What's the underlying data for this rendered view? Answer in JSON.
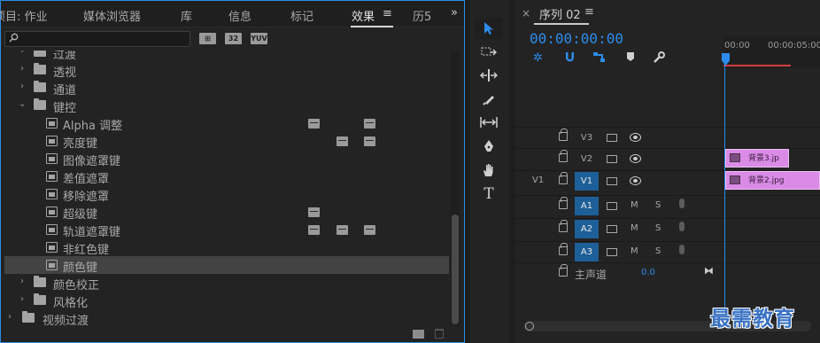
{
  "effects_panel": {
    "tabs": [
      {
        "label": "项目: 作业",
        "active": false
      },
      {
        "label": "媒体浏览器",
        "active": false
      },
      {
        "label": "库",
        "active": false
      },
      {
        "label": "信息",
        "active": false
      },
      {
        "label": "标记",
        "active": false
      },
      {
        "label": "效果",
        "active": true
      },
      {
        "label": "历5",
        "active": false
      }
    ],
    "menu_icon": "hamburger-icon",
    "overflow_icon": "double-chevron-right-icon",
    "search": {
      "value": "",
      "placeholder": ""
    },
    "accel_badges": [
      "accelerated-effects-icon",
      "32-bit-color-icon",
      "yuv-effects-icon"
    ],
    "tree": [
      {
        "label": "过渡",
        "type": "folder",
        "expanded": false,
        "level": 1
      },
      {
        "label": "透视",
        "type": "folder",
        "expanded": false,
        "level": 1
      },
      {
        "label": "通道",
        "type": "folder",
        "expanded": false,
        "level": 1
      },
      {
        "label": "键控",
        "type": "folder",
        "expanded": true,
        "level": 1
      },
      {
        "label": "Alpha 调整",
        "type": "effect",
        "level": 2,
        "badges": [
          "accel",
          "yuv"
        ]
      },
      {
        "label": "亮度键",
        "type": "effect",
        "level": 2,
        "badges": [
          "32",
          "yuv"
        ]
      },
      {
        "label": "图像遮罩键",
        "type": "effect",
        "level": 2,
        "badges": []
      },
      {
        "label": "差值遮罩",
        "type": "effect",
        "level": 2,
        "badges": []
      },
      {
        "label": "移除遮罩",
        "type": "effect",
        "level": 2,
        "badges": []
      },
      {
        "label": "超级键",
        "type": "effect",
        "level": 2,
        "badges": [
          "accel"
        ]
      },
      {
        "label": "轨道遮罩键",
        "type": "effect",
        "level": 2,
        "badges": [
          "accel",
          "32",
          "yuv"
        ]
      },
      {
        "label": "非红色键",
        "type": "effect",
        "level": 2,
        "badges": []
      },
      {
        "label": "颜色键",
        "type": "effect",
        "level": 2,
        "badges": [],
        "selected": true
      },
      {
        "label": "颜色校正",
        "type": "folder",
        "expanded": false,
        "level": 1
      },
      {
        "label": "风格化",
        "type": "folder",
        "expanded": false,
        "level": 1
      },
      {
        "label": "视频过渡",
        "type": "folder",
        "expanded": false,
        "level": 0
      }
    ],
    "bottom_icons": [
      "new-custom-bin-icon",
      "delete-icon"
    ]
  },
  "tools": [
    "selection-tool-icon",
    "track-select-icon",
    "ripple-edit-icon",
    "razor-icon",
    "slip-icon",
    "pen-icon",
    "hand-icon",
    "type-tool-icon"
  ],
  "timeline": {
    "close_label": "×",
    "sequence_title": "序列 02",
    "menu_label": "≡",
    "timecode": "00:00:00:00",
    "toolbar_icons": [
      "nest-icon",
      "snap-icon",
      "linked-selection-icon",
      "add-marker-icon",
      "settings-wrench-icon"
    ],
    "ruler": [
      "00:00",
      "00:00:05:00"
    ],
    "video_tracks": [
      {
        "name": "V3",
        "source": "",
        "active": false
      },
      {
        "name": "V2",
        "source": "",
        "active": false
      },
      {
        "name": "V1",
        "source": "V1",
        "active": true
      }
    ],
    "audio_tracks": [
      {
        "name": "A1",
        "m": "M",
        "s": "S"
      },
      {
        "name": "A2",
        "m": "M",
        "s": "S"
      },
      {
        "name": "A3",
        "m": "M",
        "s": "S"
      }
    ],
    "master": {
      "label": "主声道",
      "value": "0.0"
    },
    "clips": [
      {
        "track": "V2",
        "label": "背景3.jp",
        "color": "#d98be6"
      },
      {
        "track": "V1",
        "label": "背景2.jpg",
        "color": "#d98be6"
      }
    ]
  },
  "watermark": "最需教育"
}
